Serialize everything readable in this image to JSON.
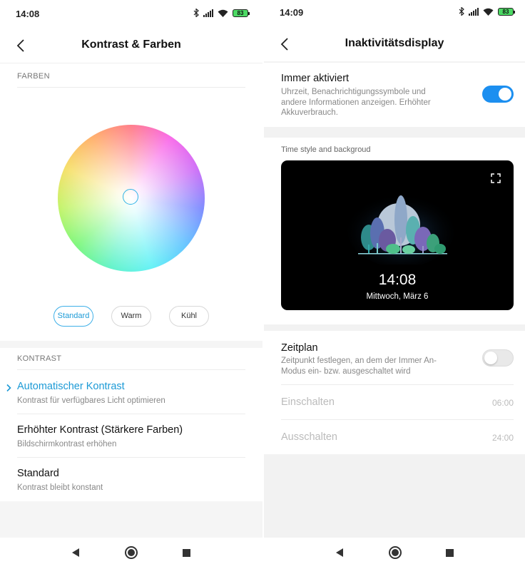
{
  "left_screen": {
    "status": {
      "time": "14:08",
      "battery": "83"
    },
    "title": "Kontrast & Farben",
    "colors_section": {
      "label": "FARBEN",
      "presets": [
        {
          "label": "Standard",
          "selected": true
        },
        {
          "label": "Warm",
          "selected": false
        },
        {
          "label": "Kühl",
          "selected": false
        }
      ]
    },
    "contrast_section": {
      "label": "KONTRAST",
      "items": [
        {
          "title": "Automatischer Kontrast",
          "subtitle": "Kontrast für verfügbares Licht optimieren",
          "selected": true
        },
        {
          "title": "Erhöhter Kontrast (Stärkere Farben)",
          "subtitle": "Bildschirmkontrast erhöhen",
          "selected": false
        },
        {
          "title": "Standard",
          "subtitle": "Kontrast bleibt konstant",
          "selected": false
        }
      ]
    }
  },
  "right_screen": {
    "status": {
      "time": "14:09",
      "battery": "83"
    },
    "title": "Inaktivitätsdisplay",
    "always_on": {
      "title": "Immer aktiviert",
      "description": "Uhrzeit, Benachrichtigungssymbole und andere Informationen anzeigen. Erhöhter Akkuverbrauch.",
      "enabled": true
    },
    "style": {
      "label": "Time style and backgroud",
      "preview_time": "14:08",
      "preview_date": "Mittwoch, März 6"
    },
    "schedule": {
      "title": "Zeitplan",
      "description": "Zeitpunkt festlegen, an dem der Immer An-Modus ein- bzw. ausgeschaltet wird",
      "enabled": false,
      "rows": [
        {
          "label": "Einschalten",
          "value": "06:00"
        },
        {
          "label": "Ausschalten",
          "value": "24:00"
        }
      ]
    }
  },
  "colors": {
    "accent": "#1c9ad6",
    "toggle_on": "#1c8ff0",
    "battery": "#4cd964"
  },
  "icons": [
    "back-icon",
    "bluetooth-icon",
    "signal-icon",
    "wifi-icon",
    "battery-icon",
    "chevron-right-icon",
    "expand-icon",
    "nav-back-icon",
    "nav-home-icon",
    "nav-recents-icon"
  ]
}
